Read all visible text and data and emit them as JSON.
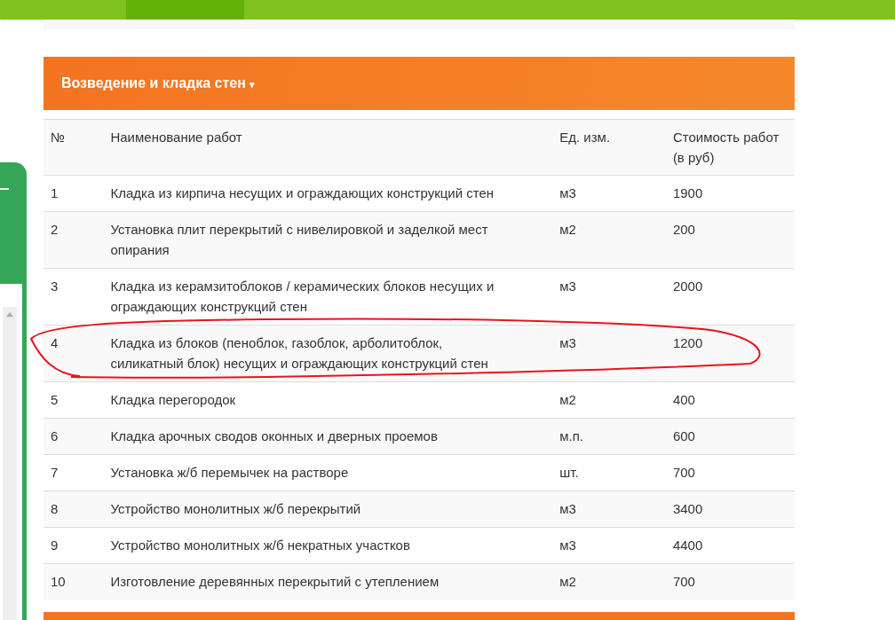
{
  "section": {
    "title": "Возведение и кладка стен",
    "caret": "▾"
  },
  "table": {
    "columns": [
      "№",
      "Наименование работ",
      "Ед. изм.",
      "Стоимость работ (в руб)"
    ],
    "rows": [
      [
        "1",
        "Кладка из кирпича несущих и ограждающих конструкций стен",
        "м3",
        "1900"
      ],
      [
        "2",
        "Установка плит перекрытий с нивелировкой и заделкой мест опирания",
        "м2",
        "200"
      ],
      [
        "3",
        "Кладка из керамзитоблоков / керамических блоков несущих и ограждающих конструкций стен",
        "м3",
        "2000"
      ],
      [
        "4",
        "Кладка из блоков (пеноблок, газоблок, арболитоблок, силикатный блок) несущих и ограждающих конструкций стен",
        "м3",
        "1200"
      ],
      [
        "5",
        "Кладка перегородок",
        "м2",
        "400"
      ],
      [
        "6",
        "Кладка арочных сводов оконных и дверных проемов",
        "м.п.",
        "600"
      ],
      [
        "7",
        "Установка ж/б перемычек на растворе",
        "шт.",
        "700"
      ],
      [
        "8",
        "Устройство монолитных ж/б перекрытий",
        "м3",
        "3400"
      ],
      [
        "9",
        "Устройство монолитных ж/б некратных участков",
        "м3",
        "4400"
      ],
      [
        "10",
        "Изготовление деревянных перекрытий с утеплением",
        "м2",
        "700"
      ]
    ]
  }
}
